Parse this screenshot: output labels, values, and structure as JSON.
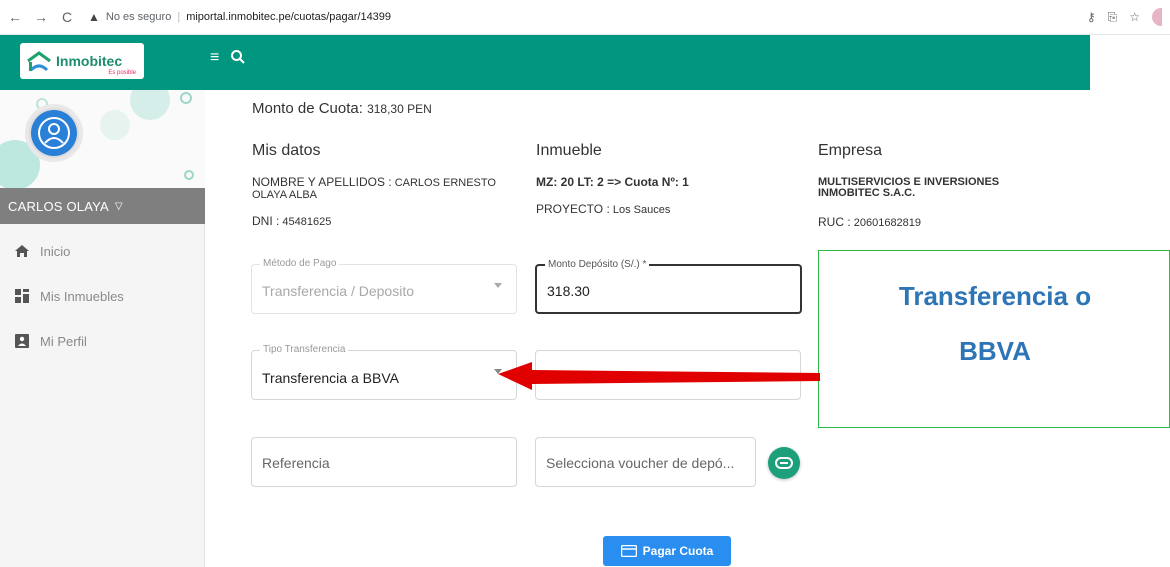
{
  "browser": {
    "insecure_label": "No es seguro",
    "url": "miportal.inmobitec.pe/cuotas/pagar/14399"
  },
  "brand": {
    "name": "Inmobitec",
    "tagline": "Es posible",
    "color_primary": "#00967f"
  },
  "sidebar": {
    "user_name": "CARLOS OLAYA",
    "items": [
      {
        "label": "Inicio",
        "icon": "home-icon"
      },
      {
        "label": "Mis Inmuebles",
        "icon": "grid-icon"
      },
      {
        "label": "Mi Perfil",
        "icon": "profile-card-icon"
      }
    ]
  },
  "main": {
    "cuota_label": "Monto de Cuota:",
    "cuota_value": "318,30 PEN",
    "mis_datos": {
      "title": "Mis datos",
      "nombre_label": "NOMBRE Y APELLIDOS :",
      "nombre_value_1": "CARLOS ERNESTO",
      "nombre_value_2": "OLAYA ALBA",
      "dni_label": "DNI :",
      "dni_value": "45481625"
    },
    "inmueble": {
      "title": "Inmueble",
      "lote": "MZ: 20 LT: 2 => Cuota Nº: 1",
      "proyecto_label": "PROYECTO :",
      "proyecto_value": "Los Sauces"
    },
    "empresa": {
      "title": "Empresa",
      "name_1": "MULTISERVICIOS E INVERSIONES",
      "name_2": "INMOBITEC S.A.C.",
      "ruc_label": "RUC :",
      "ruc_value": "20601682819"
    },
    "form": {
      "metodo_label": "Método de Pago",
      "metodo_value": "Transferencia / Deposito",
      "monto_label": "Monto Depósito (S/.) *",
      "monto_value": "318.30",
      "tipo_label": "Tipo Transferencia",
      "tipo_value": "Transferencia a BBVA",
      "referencia_placeholder": "Referencia",
      "voucher_placeholder": "Selecciona voucher de depó..."
    },
    "pay_button": "Pagar Cuota"
  },
  "annotation": {
    "line_1": "Transferencia o",
    "line_2": "BBVA",
    "arrow_color": "#e00000",
    "text_color": "#2e75b6",
    "border_color": "#2fb84a"
  }
}
